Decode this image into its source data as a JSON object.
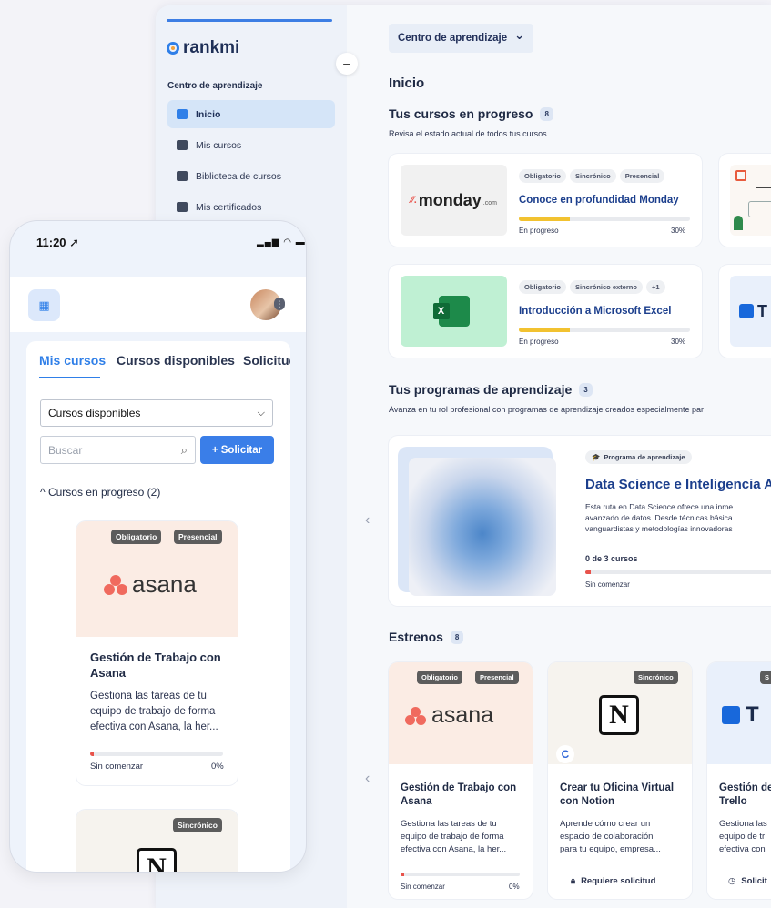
{
  "sidebar": {
    "brand": "rankmi",
    "collapse": "–",
    "section_title": "Centro de aprendizaje",
    "items": [
      {
        "label": "Inicio",
        "icon": "home-icon"
      },
      {
        "label": "Mis cursos",
        "icon": "book-icon"
      },
      {
        "label": "Biblioteca de cursos",
        "icon": "library-icon"
      },
      {
        "label": "Mis certificados",
        "icon": "certificate-icon"
      }
    ]
  },
  "header": {
    "dropdown": "Centro de aprendizaje",
    "dropdown_caret": "⌄"
  },
  "main": {
    "page_title": "Inicio",
    "progress_section": {
      "title": "Tus cursos en progreso",
      "count": "8",
      "subtitle": "Revisa el estado actual de todos tus cursos.",
      "cards": [
        {
          "tags": [
            "Obligatorio",
            "Sincrónico",
            "Presencial"
          ],
          "title": "Conoce en profundidad Monday",
          "status": "En progreso",
          "percent": "30%",
          "progress": 30,
          "logo": "monday"
        },
        {
          "tags": [
            "Obligatorio",
            "Sincrónico externo",
            "+1"
          ],
          "title": "Introducción a Microsoft Excel",
          "status": "En progreso",
          "percent": "30%",
          "progress": 30,
          "logo": "excel"
        }
      ]
    },
    "programs_section": {
      "title": "Tus programas de aprendizaje",
      "count": "3",
      "subtitle": "Avanza en tu rol profesional con programas de aprendizaje creados especialmente par",
      "program": {
        "badge": "Programa de aprendizaje",
        "title": "Data Science e Inteligencia A",
        "desc_lines": [
          "Esta ruta en Data Science ofrece una inme",
          "avanzado de datos. Desde técnicas básica",
          "vanguardistas y metodologías innovadoras"
        ],
        "courses": "0 de 3 cursos",
        "status": "Sin comenzar",
        "progress": 3
      },
      "prev_arrow": "‹"
    },
    "premieres_section": {
      "title": "Estrenos",
      "count": "8",
      "prev_arrow": "‹",
      "cards": [
        {
          "chips": [
            "Obligatorio",
            "Presencial"
          ],
          "logo": "asana",
          "title_lines": [
            "Gestión de Trabajo con",
            "Asana"
          ],
          "desc_lines": [
            "Gestiona las tareas de tu",
            "equipo de trabajo de forma",
            "efectiva con Asana, la her..."
          ],
          "status": "Sin comenzar",
          "percent": "0%",
          "progress": 3
        },
        {
          "chips": [
            "Sincrónico"
          ],
          "logo": "notion",
          "title_lines": [
            "Crear tu Oficina Virtual",
            "con Notion"
          ],
          "desc_lines": [
            "Aprende cómo crear un",
            "espacio de colaboración",
            "para tu equipo, empresa..."
          ],
          "action": "Requiere solicitud"
        },
        {
          "chips": [
            "S"
          ],
          "logo": "trello",
          "title_lines": [
            "Gestión de",
            "Trello"
          ],
          "desc_lines": [
            "Gestiona las",
            "equipo de tr",
            "efectiva con"
          ],
          "action": "Solicit"
        }
      ]
    }
  },
  "phone": {
    "time": "11:20 ➚",
    "status_icons": "▂▄▆ ◠ ▬",
    "tabs": [
      "Mis cursos",
      "Cursos disponibles",
      "Solicitud"
    ],
    "select_value": "Cursos disponibles",
    "search_placeholder": "Buscar",
    "request_button": "+ Solicitar",
    "section_toggle": "^ Cursos en progreso (2)",
    "card": {
      "chips": [
        "Obligatorio",
        "Presencial"
      ],
      "title_lines": [
        "Gestión de Trabajo con",
        "Asana"
      ],
      "desc_lines": [
        "Gestiona las tareas de tu",
        "equipo de trabajo de forma",
        "efectiva con Asana, la her..."
      ],
      "status": "Sin comenzar",
      "percent": "0%",
      "progress": 3
    },
    "card2_chip": "Sincrónico",
    "avatar_more": "⋮"
  },
  "logos": {
    "monday": "monday",
    "monday_suffix": ".com",
    "asana": "asana",
    "excel": "X",
    "notion": "N",
    "trello": "T",
    "c_badge": "C"
  },
  "colors": {
    "accent": "#2f7fe8",
    "progress": "#f2c230",
    "progress_start": "#e8534b",
    "excel_bg": "#bff0d3"
  }
}
